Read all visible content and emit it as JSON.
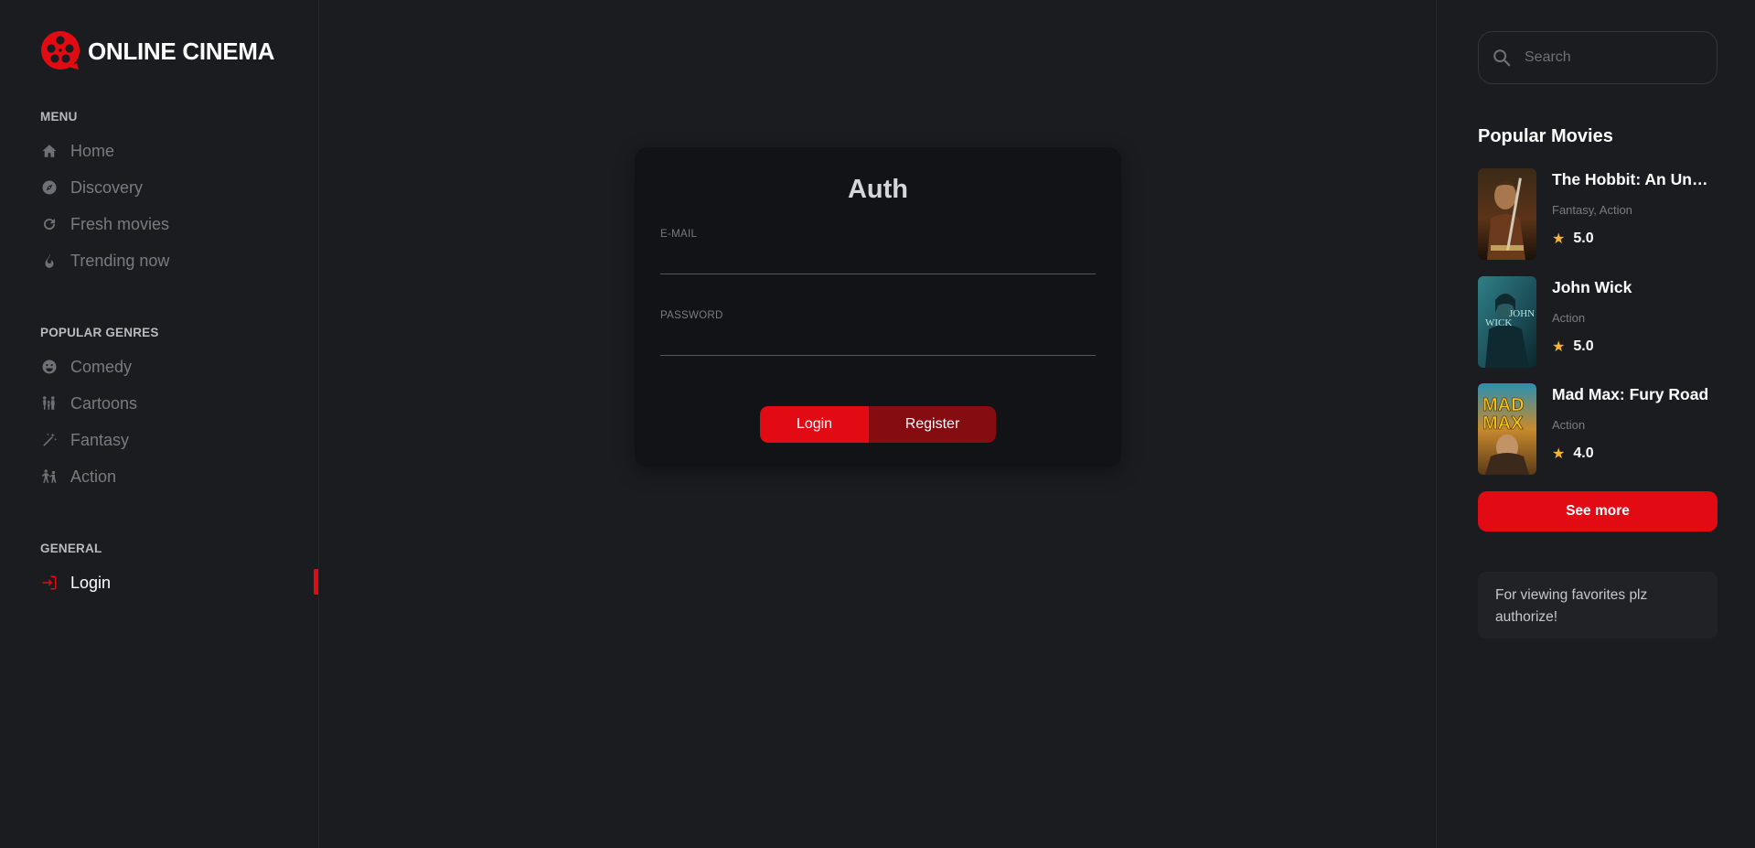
{
  "brand": {
    "name": "ONLINE CINEMA",
    "accent": "#e30b13"
  },
  "menu": {
    "heading": "MENU",
    "items": [
      {
        "label": "Home",
        "icon": "home-icon"
      },
      {
        "label": "Discovery",
        "icon": "compass-icon"
      },
      {
        "label": "Fresh movies",
        "icon": "refresh-icon"
      },
      {
        "label": "Trending now",
        "icon": "fire-icon"
      }
    ]
  },
  "genres": {
    "heading": "POPULAR GENRES",
    "items": [
      {
        "label": "Comedy",
        "icon": "smile-icon"
      },
      {
        "label": "Cartoons",
        "icon": "family-icon"
      },
      {
        "label": "Fantasy",
        "icon": "magic-wand-icon"
      },
      {
        "label": "Action",
        "icon": "fight-icon"
      }
    ]
  },
  "general": {
    "heading": "GENERAL",
    "items": [
      {
        "label": "Login",
        "icon": "login-icon",
        "active": true
      }
    ]
  },
  "auth": {
    "title": "Auth",
    "email_label": "E-MAIL",
    "email_value": "",
    "password_label": "PASSWORD",
    "password_value": "",
    "login_label": "Login",
    "register_label": "Register"
  },
  "search": {
    "placeholder": "Search"
  },
  "popular": {
    "title": "Popular Movies",
    "movies": [
      {
        "title": "The Hobbit: An Unexpected Journey",
        "genres": "Fantasy, Action",
        "rating": "5.0"
      },
      {
        "title": "John Wick",
        "genres": "Action",
        "rating": "5.0"
      },
      {
        "title": "Mad Max: Fury Road",
        "genres": "Action",
        "rating": "4.0"
      }
    ],
    "see_more_label": "See more"
  },
  "favorites_note": "For viewing favorites plz authorize!"
}
